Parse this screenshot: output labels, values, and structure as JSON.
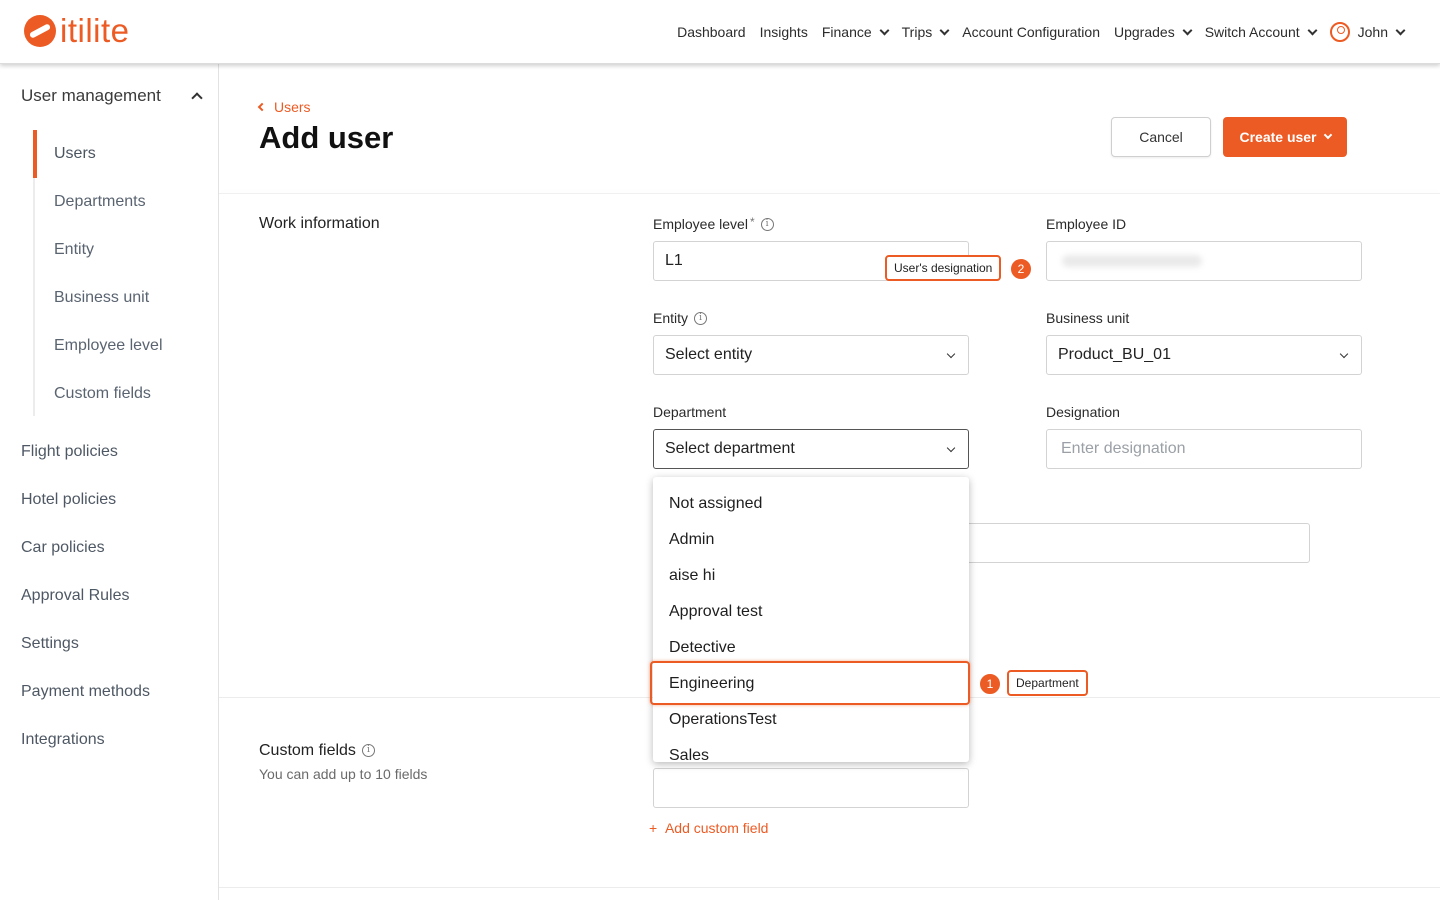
{
  "brand": {
    "name": "itilite"
  },
  "nav": {
    "items": [
      {
        "label": "Dashboard",
        "has_menu": false
      },
      {
        "label": "Insights",
        "has_menu": false
      },
      {
        "label": "Finance",
        "has_menu": true
      },
      {
        "label": "Trips",
        "has_menu": true
      },
      {
        "label": "Account Configuration",
        "has_menu": false
      },
      {
        "label": "Upgrades",
        "has_menu": true
      },
      {
        "label": "Switch Account",
        "has_menu": true
      }
    ],
    "user": "John"
  },
  "sidebar": {
    "group_label": "User management",
    "sub_items": [
      "Users",
      "Departments",
      "Entity",
      "Business unit",
      "Employee level",
      "Custom fields"
    ],
    "active": "Users",
    "main_items": [
      "Flight policies",
      "Hotel policies",
      "Car policies",
      "Approval Rules",
      "Settings",
      "Payment methods",
      "Integrations"
    ]
  },
  "page": {
    "breadcrumb": "Users",
    "title": "Add user",
    "cancel_label": "Cancel",
    "create_label": "Create user"
  },
  "work": {
    "section_title": "Work information",
    "employee_level": {
      "label": "Employee level",
      "value": "L1"
    },
    "employee_id": {
      "label": "Employee ID"
    },
    "entity": {
      "label": "Entity",
      "value": "Select entity"
    },
    "business_unit": {
      "label": "Business unit",
      "value": "Product_BU_01"
    },
    "department": {
      "label": "Department",
      "value": "Select department"
    },
    "designation": {
      "label": "Designation",
      "placeholder": "Enter designation"
    }
  },
  "department_options": [
    "Not assigned",
    "Admin",
    "aise hi",
    "Approval test",
    "Detective",
    "Engineering",
    "OperationsTest",
    "Sales"
  ],
  "highlighted_option": "Engineering",
  "annotations": [
    {
      "number": "1",
      "label": "Department"
    },
    {
      "number": "2",
      "label": "User's designation"
    }
  ],
  "custom": {
    "title": "Custom fields",
    "subtitle": "You can add up to 10 fields",
    "add_label": "Add custom field"
  },
  "colors": {
    "accent": "#ec5b24",
    "text": "#1c1c1c",
    "muted": "#5a6470"
  }
}
